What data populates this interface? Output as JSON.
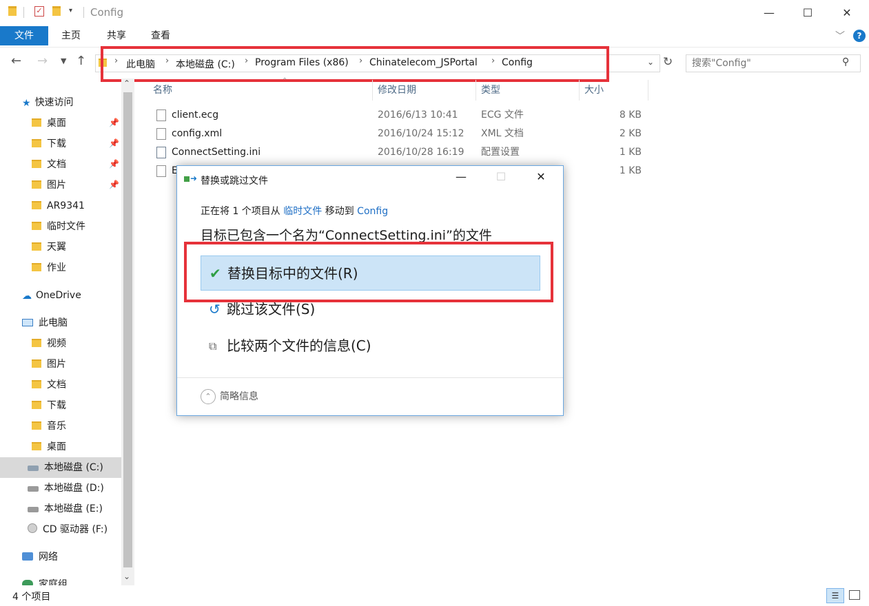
{
  "window": {
    "title": "Config"
  },
  "ribbon": {
    "tabs": [
      "文件",
      "主页",
      "共享",
      "查看"
    ]
  },
  "address": {
    "crumbs": [
      "此电脑",
      "本地磁盘 (C:)",
      "Program Files (x86)",
      "Chinatelecom_JSPortal",
      "Config"
    ]
  },
  "search": {
    "placeholder": "搜索\"Config\""
  },
  "nav": {
    "quick_access": "快速访问",
    "quick_items": [
      "桌面",
      "下载",
      "文档",
      "图片",
      "AR9341",
      "临时文件",
      "天翼",
      "作业"
    ],
    "onedrive": "OneDrive",
    "this_pc": "此电脑",
    "pc_items": [
      "视频",
      "图片",
      "文档",
      "下载",
      "音乐",
      "桌面",
      "本地磁盘 (C:)",
      "本地磁盘 (D:)",
      "本地磁盘 (E:)",
      "CD 驱动器 (F:)"
    ],
    "network": "网络",
    "homegroup": "家庭组"
  },
  "columns": {
    "name": "名称",
    "date": "修改日期",
    "type": "类型",
    "size": "大小"
  },
  "files": [
    {
      "name": "client.ecg",
      "date": "2016/6/13 10:41",
      "type": "ECG 文件",
      "size": "8 KB"
    },
    {
      "name": "config.xml",
      "date": "2016/10/24 15:12",
      "type": "XML 文档",
      "size": "2 KB"
    },
    {
      "name": "ConnectSetting.ini",
      "date": "2016/10/28 16:19",
      "type": "配置设置",
      "size": "1 KB"
    },
    {
      "name": "E",
      "date": "",
      "type": "",
      "size": "1 KB"
    }
  ],
  "status": {
    "item_count": "4 个项目"
  },
  "dialog": {
    "title": "替换或跳过文件",
    "line1_prefix": "正在将 1 个项目从 ",
    "line1_source": "临时文件",
    "line1_middle": " 移动到 ",
    "line1_dest": "Config",
    "message": "目标已包含一个名为“ConnectSetting.ini”的文件",
    "option_replace": "替换目标中的文件(R)",
    "option_skip": "跳过该文件(S)",
    "option_compare": "比较两个文件的信息(C)",
    "details_toggle": "简略信息"
  },
  "colors": {
    "accent": "#1979ca",
    "highlight_box": "#e6323a",
    "selected_option": "#cce4f7",
    "link": "#1f6fc5"
  }
}
